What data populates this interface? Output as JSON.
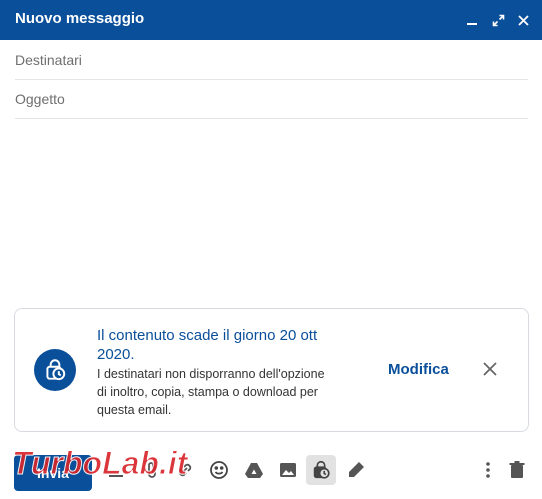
{
  "window": {
    "title": "Nuovo messaggio"
  },
  "fields": {
    "to_placeholder": "Destinatari",
    "subject_placeholder": "Oggetto"
  },
  "confidential_notice": {
    "title": "Il contenuto scade il giorno 20 ott 2020.",
    "description": "I destinatari non disporranno dell'opzione di inoltro, copia, stampa o download per questa email.",
    "edit_label": "Modifica"
  },
  "toolbar": {
    "send_label": "Invia",
    "tools": [
      "formatting-icon",
      "attach-icon",
      "link-icon",
      "emoji-icon",
      "drive-icon",
      "photo-icon",
      "confidential-mode-icon",
      "signature-icon",
      "more-options-icon",
      "trash-icon"
    ]
  },
  "watermark": {
    "text": "TurboLab.it"
  },
  "colors": {
    "accent": "#0a4f9a",
    "watermark_red": "#d8262b"
  }
}
